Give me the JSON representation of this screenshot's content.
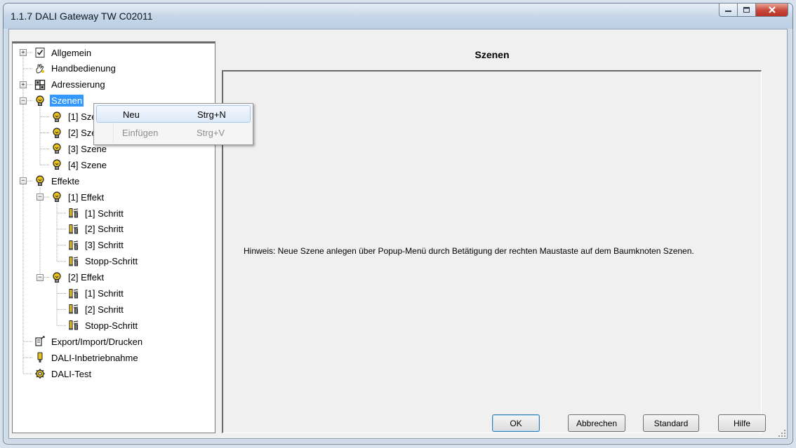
{
  "window": {
    "title": "1.1.7 DALI Gateway TW C02011",
    "caption_buttons": [
      "minimize-icon",
      "maximize-icon",
      "close-icon"
    ]
  },
  "tree": {
    "items": [
      {
        "label": "Allgemein",
        "icon": "checklist-icon",
        "expander": "+"
      },
      {
        "label": "Handbedienung",
        "icon": "hand-icon"
      },
      {
        "label": "Adressierung",
        "icon": "grid-icon",
        "expander": "+"
      },
      {
        "label": "Szenen",
        "icon": "bulb-icon",
        "expander": "-",
        "selected": true
      },
      {
        "label": "[1] Szene",
        "icon": "bulb-icon"
      },
      {
        "label": "[2] Szene",
        "icon": "bulb-icon"
      },
      {
        "label": "[3] Szene",
        "icon": "bulb-icon"
      },
      {
        "label": "[4] Szene",
        "icon": "bulb-icon"
      },
      {
        "label": "Effekte",
        "icon": "bulb-icon",
        "expander": "-"
      },
      {
        "label": "[1] Effekt",
        "icon": "bulb-icon",
        "expander": "-"
      },
      {
        "label": "[1] Schritt",
        "icon": "step-icon"
      },
      {
        "label": "[2] Schritt",
        "icon": "step-icon"
      },
      {
        "label": "[3] Schritt",
        "icon": "step-icon"
      },
      {
        "label": "Stopp-Schritt",
        "icon": "step-icon"
      },
      {
        "label": "[2] Effekt",
        "icon": "bulb-icon",
        "expander": "-"
      },
      {
        "label": "[1] Schritt",
        "icon": "step-icon"
      },
      {
        "label": "[2] Schritt",
        "icon": "step-icon"
      },
      {
        "label": "Stopp-Schritt",
        "icon": "step-icon"
      },
      {
        "label": "Export/Import/Drucken",
        "icon": "export-icon"
      },
      {
        "label": "DALI-Inbetriebnahme",
        "icon": "wrench-icon"
      },
      {
        "label": "DALI-Test",
        "icon": "gear-icon"
      }
    ]
  },
  "context_menu": {
    "items": [
      {
        "label": "Neu",
        "shortcut": "Strg+N",
        "enabled": true
      },
      {
        "label": "Einfügen",
        "shortcut": "Strg+V",
        "enabled": false
      }
    ]
  },
  "content": {
    "heading": "Szenen",
    "hint": "Hinweis: Neue Szene anlegen über Popup-Menü durch Betätigung der rechten  Maustaste auf dem Baumknoten Szenen."
  },
  "buttons": {
    "ok": "OK",
    "cancel": "Abbrechen",
    "standard": "Standard",
    "help": "Hilfe"
  },
  "colors": {
    "selection": "#3399ff",
    "icon_yellow": "#e8c21a",
    "close_red": "#c7473a"
  }
}
